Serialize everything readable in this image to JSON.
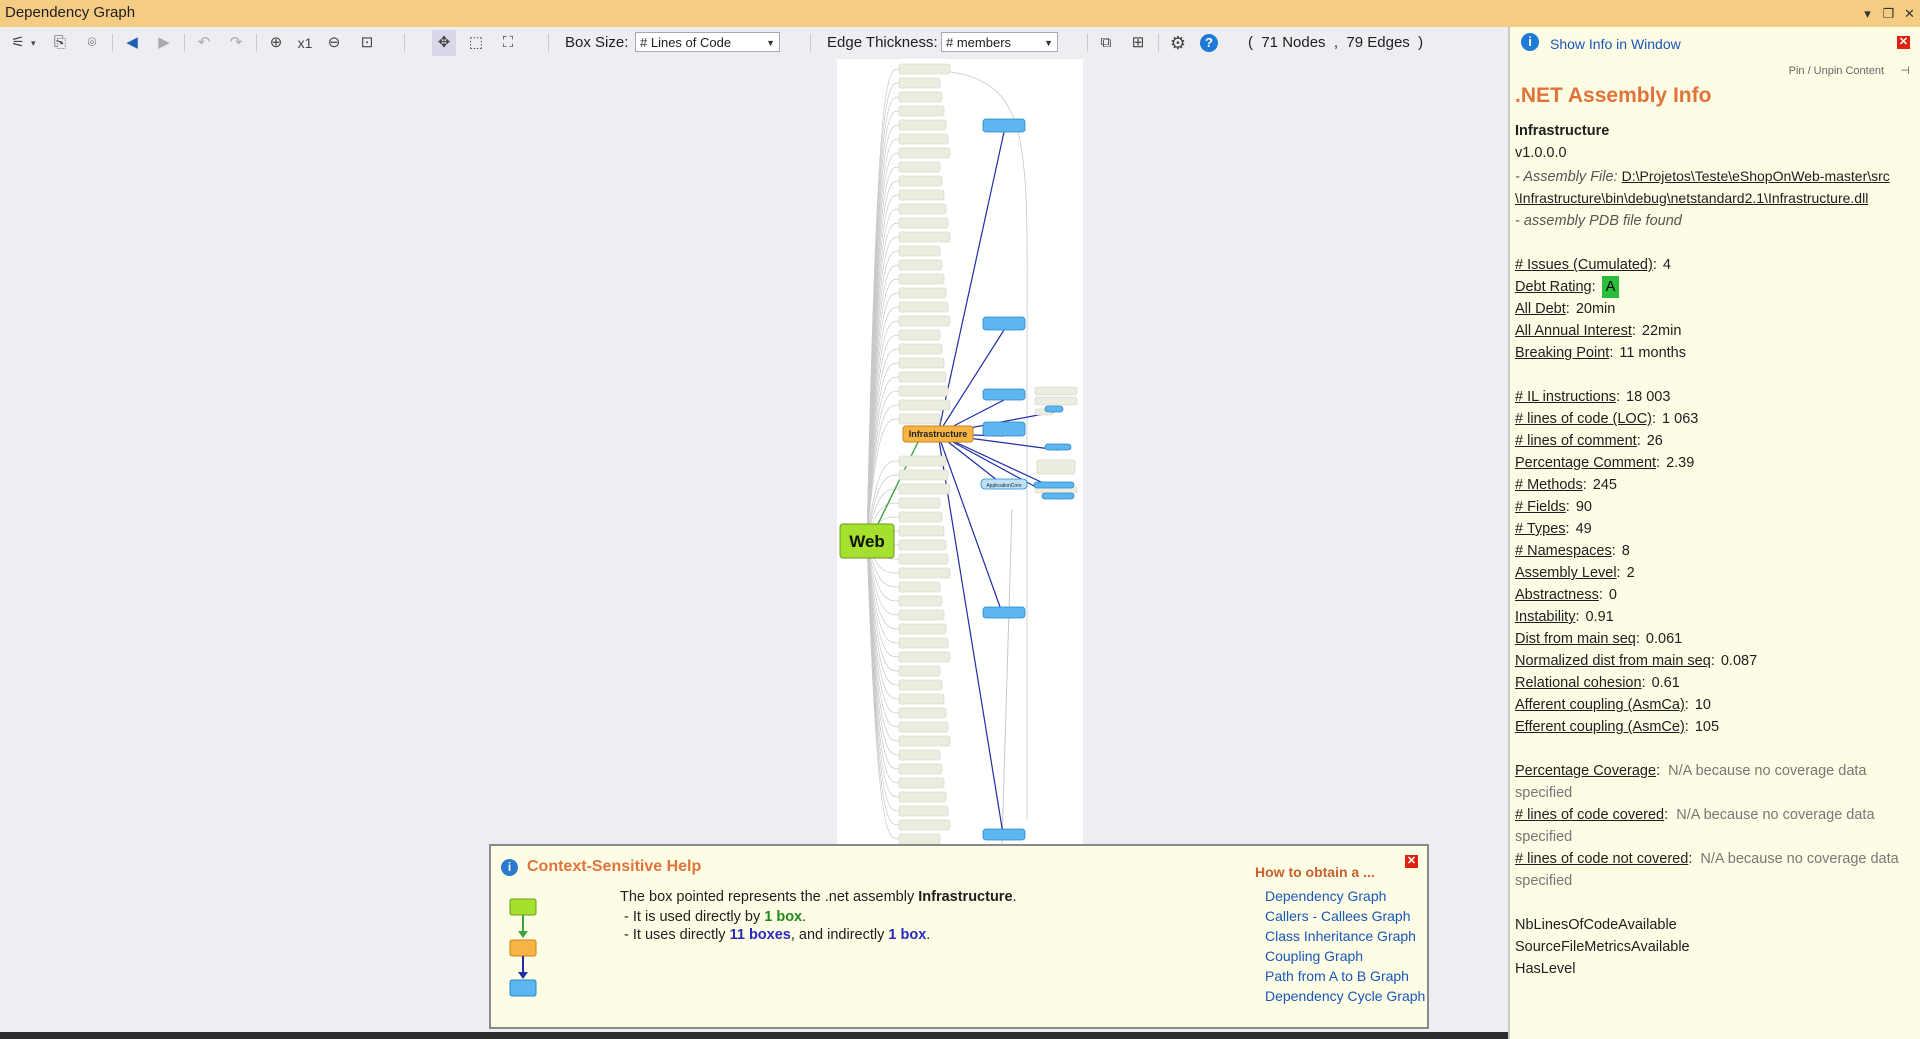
{
  "window": {
    "title": "Dependency Graph"
  },
  "toolbar": {
    "zoom_level": "x1",
    "box_size_label": "Box Size:",
    "box_size_value": "# Lines of Code",
    "edge_thickness_label": "Edge Thickness:",
    "edge_thickness_value": "# members",
    "stats_open": "(",
    "nodes": "71 Nodes",
    "comma": ",",
    "edges": "79 Edges",
    "stats_close": ")"
  },
  "graph": {
    "center_node": "Infrastructure",
    "root_node": "Web",
    "secondary_node": "ApplicationCore",
    "colors": {
      "web": "#a6e02e",
      "infrastructure": "#f6b443",
      "used": "#5cb7f0",
      "other": "#ecece0",
      "edge_used": "#1e2fa8",
      "edge_caller": "#3da23d",
      "edge_other": "#c8c8c8"
    }
  },
  "panel": {
    "show_info": "Show Info in Window",
    "pin": "Pin / Unpin Content",
    "title": ".NET Assembly Info",
    "assembly_name": "Infrastructure",
    "version": "v1.0.0.0",
    "file_label": "- Assembly File:",
    "file_path_1": "D:\\Projetos\\Teste\\eShopOnWeb-master\\src",
    "file_path_2": "\\Infrastructure\\bin\\debug\\netstandard2.1\\Infrastructure.dll",
    "pdb": "- assembly PDB file found",
    "metrics1": [
      {
        "k": "# Issues (Cumulated)",
        "v": "4"
      },
      {
        "k": "Debt Rating",
        "v": "A",
        "badge": true
      },
      {
        "k": "All Debt",
        "v": "20min"
      },
      {
        "k": "All Annual Interest",
        "v": "22min"
      },
      {
        "k": "Breaking Point",
        "v": "11 months"
      }
    ],
    "metrics2": [
      {
        "k": "# IL instructions",
        "v": "18 003"
      },
      {
        "k": "# lines of code (LOC)",
        "v": "1 063"
      },
      {
        "k": "# lines of comment",
        "v": "26"
      },
      {
        "k": "Percentage Comment",
        "v": "2.39"
      },
      {
        "k": "# Methods",
        "v": "245"
      },
      {
        "k": "# Fields",
        "v": "90"
      },
      {
        "k": "# Types",
        "v": "49"
      },
      {
        "k": "# Namespaces",
        "v": "8"
      },
      {
        "k": "Assembly Level",
        "v": "2"
      },
      {
        "k": "Abstractness",
        "v": "0"
      },
      {
        "k": "Instability",
        "v": "0.91"
      },
      {
        "k": "Dist from main seq",
        "v": "0.061"
      },
      {
        "k": "Normalized dist from main seq",
        "v": "0.087"
      },
      {
        "k": "Relational cohesion",
        "v": "0.61"
      },
      {
        "k": "Afferent coupling (AsmCa)",
        "v": "10"
      },
      {
        "k": "Efferent coupling (AsmCe)",
        "v": "105"
      }
    ],
    "coverage": [
      {
        "k": "Percentage Coverage",
        "v1": "N/A because no coverage data",
        "v2": "specified"
      },
      {
        "k": "# lines of code covered",
        "v1": "N/A because no coverage data",
        "v2": "specified"
      },
      {
        "k": "# lines of code not covered",
        "v1": "N/A because no coverage data",
        "v2": "specified"
      }
    ],
    "flags": [
      "NbLinesOfCodeAvailable",
      "SourceFileMetricsAvailable",
      "HasLevel"
    ]
  },
  "help": {
    "title": "Context-Sensitive Help",
    "line1_pre": "The box pointed represents the .net assembly ",
    "line1_bold": "Infrastructure",
    "line1_post": ".",
    "line2_pre": "- It is used directly by ",
    "line2_val": "1 box",
    "line2_post": ".",
    "line3_pre": "- It uses directly ",
    "line3_val1": "11 boxes",
    "line3_mid": ", and indirectly ",
    "line3_val2": "1 box",
    "line3_post": ".",
    "how_title": "How to obtain a ...",
    "links": [
      "Dependency Graph",
      "Callers - Callees Graph",
      "Class Inheritance Graph",
      "Coupling Graph",
      "Path from A to B Graph",
      "Dependency Cycle Graph"
    ]
  }
}
